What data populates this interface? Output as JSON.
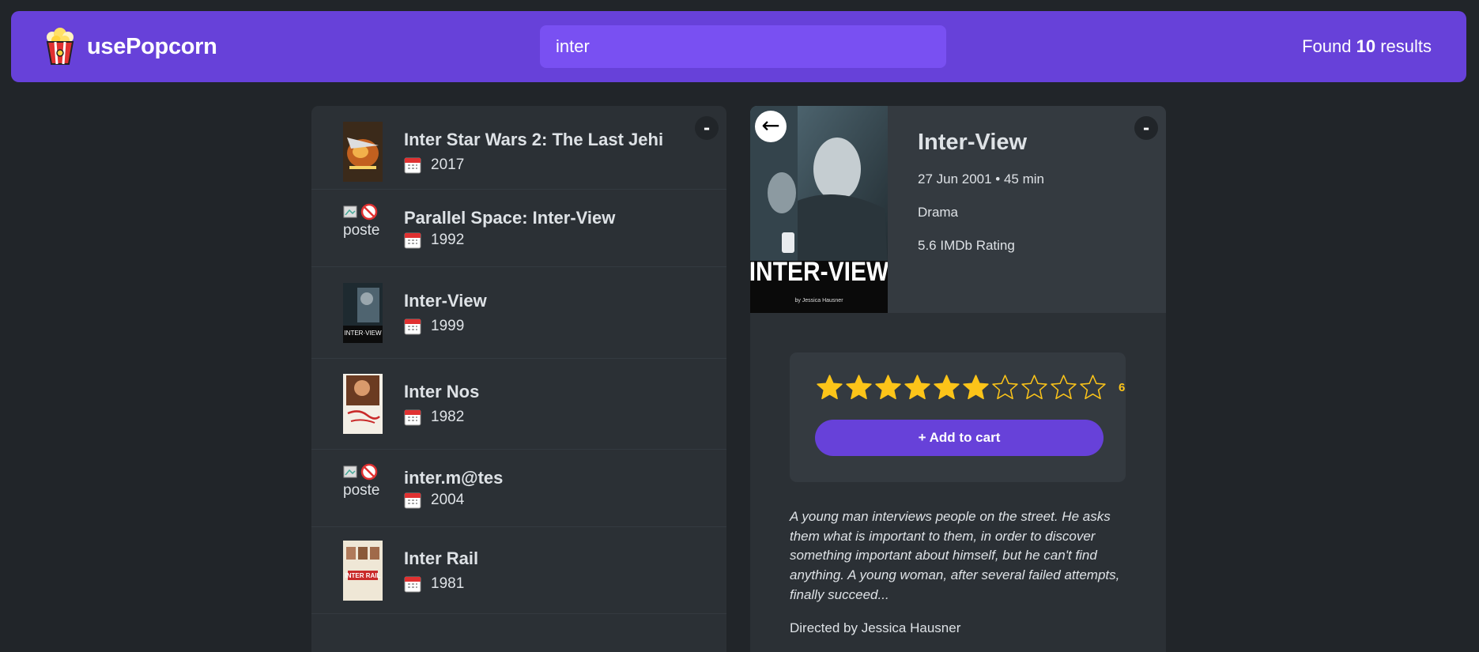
{
  "nav": {
    "logo_text": "usePopcorn",
    "search_value": "inter",
    "results_prefix": "Found",
    "results_count": "10",
    "results_suffix": "results"
  },
  "list": {
    "toggle_label": "-",
    "movies": [
      {
        "title": "Inter Star Wars 2: The Last Jehi",
        "year": "2017",
        "poster_alt": ""
      },
      {
        "title": "Parallel Space: Inter-View",
        "year": "1992",
        "poster_alt": "poste"
      },
      {
        "title": "Inter-View",
        "year": "1999",
        "poster_alt": ""
      },
      {
        "title": "Inter Nos",
        "year": "1982",
        "poster_alt": ""
      },
      {
        "title": "inter.m@tes",
        "year": "2004",
        "poster_alt": "poste"
      },
      {
        "title": "Inter Rail",
        "year": "1981",
        "poster_alt": ""
      }
    ]
  },
  "details": {
    "toggle_label": "-",
    "back_label": "←",
    "poster_text": "INTER-VIEW",
    "poster_byline": "by Jessica Hausner",
    "title": "Inter-View",
    "released_runtime": "27 Jun 2001 • 45 min",
    "genre": "Drama",
    "imdb": "5.6 IMDb Rating",
    "rating": {
      "filled": 6,
      "max": 10,
      "label": "6"
    },
    "add_button": "+ Add to cart",
    "plot": "A young man interviews people on the street. He asks them what is important to them, in order to discover something important about himself, but he can't find anything. A young woman, after several failed attempts, finally succeed...",
    "director": "Directed by Jessica Hausner"
  },
  "colors": {
    "primary": "#6741d9",
    "primary_light": "#7950f2",
    "background": "#212529",
    "box": "#2b3035",
    "star": "#fcc419"
  }
}
